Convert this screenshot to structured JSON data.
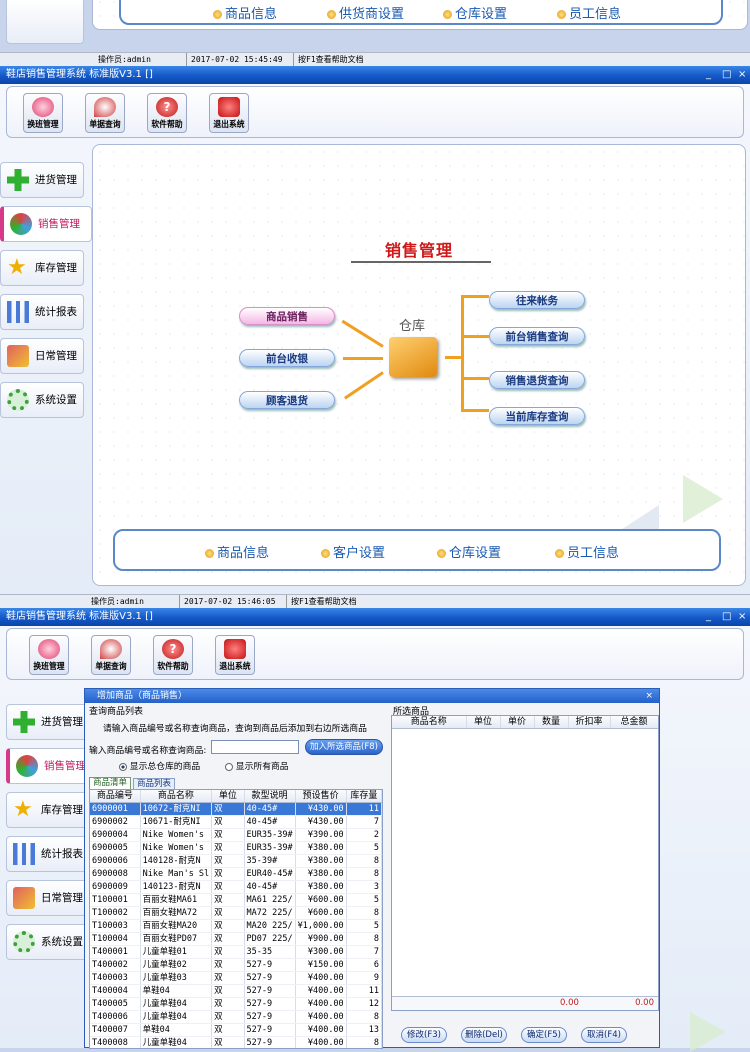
{
  "window": {
    "title": "鞋店销售管理系统 标准版V3.1 []",
    "controls": [
      "_",
      "□",
      "×"
    ]
  },
  "toolbar": [
    {
      "label": "换班管理",
      "icon": "shift-icon"
    },
    {
      "label": "单据查询",
      "icon": "search-icon"
    },
    {
      "label": "软件帮助",
      "icon": "help-icon"
    },
    {
      "label": "退出系统",
      "icon": "exit-icon"
    }
  ],
  "sidebar": [
    {
      "label": "进货管理",
      "icon": "plus-icon"
    },
    {
      "label": "销售管理",
      "icon": "globe-icon"
    },
    {
      "label": "库存管理",
      "icon": "star-icon"
    },
    {
      "label": "统计报表",
      "icon": "bar-chart-icon"
    },
    {
      "label": "日常管理",
      "icon": "wrench-icon"
    },
    {
      "label": "系统设置",
      "icon": "gear-icon"
    }
  ],
  "top_fragment": {
    "links": [
      "商品信息",
      "供货商设置",
      "仓库设置",
      "员工信息"
    ],
    "status": {
      "operator": "操作员:admin",
      "time": "2017-07-02 15:45:49",
      "hint": "按F1查看帮助文档"
    }
  },
  "sales": {
    "title": "销售管理",
    "center_label": "仓库",
    "left_buttons": [
      "商品销售",
      "前台收银",
      "顾客退货"
    ],
    "right_buttons": [
      "往来帐务",
      "前台销售查询",
      "销售退货查询",
      "当前库存查询"
    ],
    "bottom_links": [
      "商品信息",
      "客户设置",
      "仓库设置",
      "员工信息"
    ],
    "status": {
      "operator": "操作员:admin",
      "time": "2017-07-02 15:46:05",
      "hint": "按F1查看帮助文档"
    }
  },
  "dialog": {
    "title": "增加商品（商品销售）",
    "left_group": "查询商品列表",
    "right_group": "所选商品",
    "instruction": "请输入商品编号或名称查询商品，查询到商品后添加到右边所选商品",
    "search_label": "输入商品编号或名称查询商品:",
    "search_value": "",
    "add_button": "加入所选商品(F8)",
    "radio_options": [
      "显示总仓库的商品",
      "显示所有商品"
    ],
    "radio_selected": 0,
    "tabs": [
      "商品清单",
      "商品列表"
    ],
    "columns": [
      "商品编号",
      "商品名称",
      "单位",
      "款型说明",
      "预设售价",
      "库存量"
    ],
    "rows": [
      [
        "6900001",
        "10672-耐克NI",
        "双",
        "40-45#",
        "¥430.00",
        "11"
      ],
      [
        "6900002",
        "10671-耐克NI",
        "双",
        "40-45#",
        "¥430.00",
        "7"
      ],
      [
        "6900004",
        "Nike Women's",
        "双",
        "EUR35-39#",
        "¥390.00",
        "2"
      ],
      [
        "6900005",
        "Nike Women's",
        "双",
        "EUR35-39#",
        "¥380.00",
        "5"
      ],
      [
        "6900006",
        "140128-耐克N",
        "双",
        "35-39#",
        "¥380.00",
        "8"
      ],
      [
        "6900008",
        "Nike Man's Sl",
        "双",
        "EUR40-45#",
        "¥380.00",
        "8"
      ],
      [
        "6900009",
        "140123-耐克N",
        "双",
        "40-45#",
        "¥380.00",
        "3"
      ],
      [
        "T100001",
        "百丽女鞋MA61",
        "双",
        "MA61 225/",
        "¥600.00",
        "5"
      ],
      [
        "T100002",
        "百丽女鞋MA72",
        "双",
        "MA72 225/",
        "¥600.00",
        "8"
      ],
      [
        "T100003",
        "百丽女鞋MA20",
        "双",
        "MA20 225/",
        "¥1,000.00",
        "5"
      ],
      [
        "T100004",
        "百丽女鞋PD07",
        "双",
        "PD07 225/",
        "¥900.00",
        "8"
      ],
      [
        "T400001",
        "儿童单鞋01",
        "双",
        "35-35",
        "¥300.00",
        "7"
      ],
      [
        "T400002",
        "儿童单鞋02",
        "双",
        "527-9",
        "¥150.00",
        "6"
      ],
      [
        "T400003",
        "儿童单鞋03",
        "双",
        "527-9",
        "¥400.00",
        "9"
      ],
      [
        "T400004",
        "单鞋04",
        "双",
        "527-9",
        "¥400.00",
        "11"
      ],
      [
        "T400005",
        "儿童单鞋04",
        "双",
        "527-9",
        "¥400.00",
        "12"
      ],
      [
        "T400006",
        "儿童单鞋04",
        "双",
        "527-9",
        "¥400.00",
        "8"
      ],
      [
        "T400007",
        "单鞋04",
        "双",
        "527-9",
        "¥400.00",
        "13"
      ],
      [
        "T400008",
        "儿童单鞋04",
        "双",
        "527-9",
        "¥400.00",
        "8"
      ]
    ],
    "selected_columns": [
      "商品名称",
      "单位",
      "单价",
      "数量",
      "折扣率",
      "总金额"
    ],
    "totals": [
      "0.00",
      "0.00"
    ],
    "buttons": [
      "修改(F3)",
      "删除(Del)",
      "确定(F5)",
      "取消(F4)"
    ]
  }
}
